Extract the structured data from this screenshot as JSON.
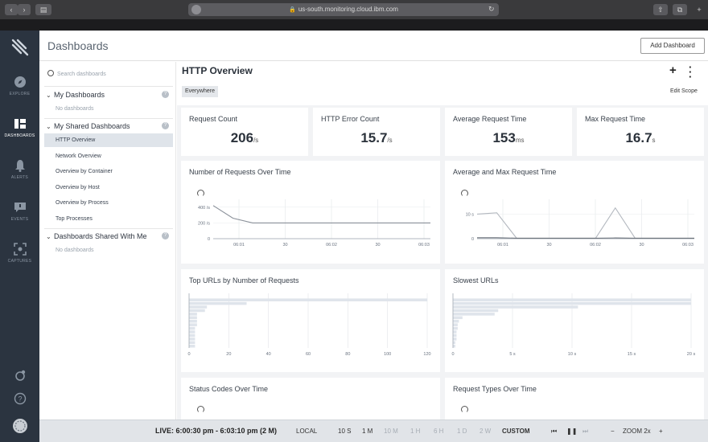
{
  "browser": {
    "url": "us-south.monitoring.cloud.ibm.com"
  },
  "sidebar": {
    "items": [
      {
        "label": "EXPLORE",
        "icon": "compass-icon"
      },
      {
        "label": "DASHBOARDS",
        "icon": "dashboard-grid-icon",
        "active": true
      },
      {
        "label": "ALERTS",
        "icon": "bell-icon"
      },
      {
        "label": "EVENTS",
        "icon": "chat-bubble-icon"
      },
      {
        "label": "CAPTURES",
        "icon": "capture-icon"
      }
    ]
  },
  "header": {
    "title": "Dashboards",
    "add_button": "Add Dashboard"
  },
  "left_panel": {
    "search_placeholder": "Search dashboards",
    "my_dashboards": {
      "title": "My Dashboards",
      "empty": "No dashboards"
    },
    "my_shared": {
      "title": "My Shared Dashboards",
      "items": [
        "HTTP Overview",
        "Network Overview",
        "Overview by Container",
        "Overview by Host",
        "Overview by Process",
        "Top Processes"
      ]
    },
    "shared_with_me": {
      "title": "Dashboards Shared With Me",
      "empty": "No dashboards"
    }
  },
  "dashboard": {
    "title": "HTTP Overview",
    "scope": "Everywhere",
    "edit_scope": "Edit Scope",
    "kpis": [
      {
        "title": "Request Count",
        "value": "206",
        "unit": "/s"
      },
      {
        "title": "HTTP Error Count",
        "value": "15.7",
        "unit": "/s"
      },
      {
        "title": "Average Request Time",
        "value": "153",
        "unit": "ms"
      },
      {
        "title": "Max Request Time",
        "value": "16.7",
        "unit": "s"
      }
    ],
    "panels": {
      "requests_over_time": "Number of Requests Over Time",
      "avg_max_time": "Average and Max Request Time",
      "top_urls": "Top URLs by Number of Requests",
      "slowest_urls": "Slowest URLs",
      "status_codes": "Status Codes Over Time",
      "request_types": "Request Types Over Time"
    }
  },
  "chart_data": [
    {
      "type": "line",
      "title": "Number of Requests Over Time",
      "x_ticks": [
        "06:01",
        "30",
        "06:02",
        "30",
        "06:03"
      ],
      "y_ticks": [
        "0",
        "200 /s",
        "400 /s"
      ],
      "ylim": [
        0,
        500
      ],
      "series": [
        {
          "values": [
            420,
            260,
            200,
            200,
            200,
            200,
            200,
            200,
            200,
            200,
            200,
            200
          ]
        }
      ]
    },
    {
      "type": "line",
      "title": "Average and Max Request Time",
      "x_ticks": [
        "06:01",
        "30",
        "06:02",
        "30",
        "06:03"
      ],
      "y_ticks": [
        "0",
        "10 s"
      ],
      "ylim": [
        0,
        16
      ],
      "series": [
        {
          "values": [
            10,
            10.5,
            0.2,
            0.2,
            0.2,
            0.2,
            0.2,
            12.5,
            0.2,
            0.2,
            0.2,
            0.2
          ]
        },
        {
          "values": [
            0.4,
            0.4,
            0.2,
            0.2,
            0.2,
            0.2,
            0.2,
            0.3,
            0.2,
            0.2,
            0.2,
            0.2
          ]
        }
      ]
    },
    {
      "type": "bar",
      "title": "Top URLs by Number of Requests",
      "orientation": "horizontal",
      "x_ticks": [
        "0",
        "20",
        "40",
        "60",
        "80",
        "100",
        "120"
      ],
      "xlim": [
        0,
        120
      ],
      "values": [
        120,
        29,
        9,
        8,
        4,
        4,
        4,
        4,
        3,
        3,
        3,
        3,
        3,
        3
      ]
    },
    {
      "type": "bar",
      "title": "Slowest URLs",
      "orientation": "horizontal",
      "x_ticks": [
        "0",
        "5 s",
        "10 s",
        "15 s",
        "20 s"
      ],
      "xlim": [
        0,
        20
      ],
      "values": [
        20,
        20,
        10.5,
        3.8,
        3.5,
        0.8,
        0.5,
        0.4,
        0.4,
        0.3,
        0.3,
        0.3,
        0.2,
        0.2
      ]
    }
  ],
  "bottom_bar": {
    "live": "LIVE: 6:00:30 pm - 6:03:10 pm (2 M)",
    "timezone": "LOCAL",
    "ranges": [
      "10 S",
      "1 M",
      "10 M",
      "1 H",
      "6 H",
      "1 D",
      "2 W",
      "CUSTOM"
    ],
    "zoom": "ZOOM 2x"
  }
}
